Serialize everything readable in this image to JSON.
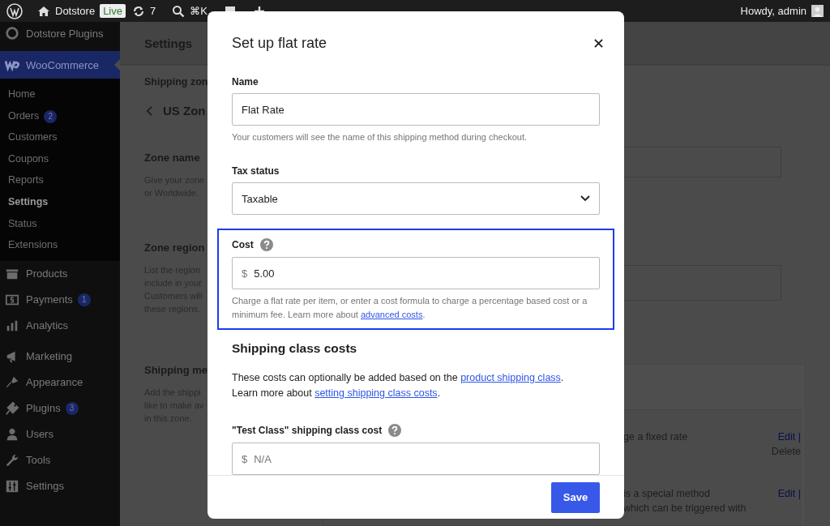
{
  "admin_bar": {
    "site_name": "Dotstore",
    "live_badge": "Live",
    "updates": "7",
    "search_shortcut": "⌘K",
    "greeting": "Howdy, admin"
  },
  "sidebar": {
    "items": [
      {
        "label": "Dotstore Plugins",
        "selected": false
      },
      {
        "label": "WooCommerce",
        "selected": true,
        "children": [
          {
            "label": "Home",
            "selected": false
          },
          {
            "label": "Orders",
            "badge": "2",
            "selected": false
          },
          {
            "label": "Customers",
            "selected": false
          },
          {
            "label": "Coupons",
            "selected": false
          },
          {
            "label": "Reports",
            "selected": false
          },
          {
            "label": "Settings",
            "selected": true
          },
          {
            "label": "Status",
            "selected": false
          },
          {
            "label": "Extensions",
            "selected": false
          }
        ]
      },
      {
        "label": "Products",
        "selected": false
      },
      {
        "label": "Payments",
        "badge": "1",
        "selected": false
      },
      {
        "label": "Analytics",
        "selected": false
      },
      {
        "label": "Marketing",
        "selected": false
      },
      {
        "label": "Appearance",
        "selected": false
      },
      {
        "label": "Plugins",
        "badge": "3",
        "selected": false
      },
      {
        "label": "Users",
        "selected": false
      },
      {
        "label": "Tools",
        "selected": false
      },
      {
        "label": "Settings",
        "selected": false
      }
    ]
  },
  "main": {
    "page_title": "Settings",
    "breadcrumb": "Shipping zon",
    "zone_title": "US Zon",
    "sections": [
      {
        "heading": "Zone name",
        "lines": [
          "Give your zone",
          "or Worldwide."
        ]
      },
      {
        "heading": "Zone region",
        "lines": [
          "List the region",
          "include in your",
          "Customers will",
          "these regions."
        ]
      },
      {
        "heading": "Shipping me",
        "lines": [
          "Add the shippi",
          "like to make av",
          "in this zone."
        ]
      }
    ],
    "methods": [
      {
        "description": [
          "ge a fixed rate"
        ],
        "actions": [
          "Edit |",
          "Delete"
        ]
      },
      {
        "description": [
          "is a special method",
          "which can be triggered with"
        ],
        "actions": [
          "Edit |"
        ]
      }
    ]
  },
  "modal": {
    "title": "Set up flat rate",
    "blocks": [
      {
        "kind": "text",
        "label": "Name",
        "value": "Flat Rate",
        "help": "Your customers will see the name of this shipping method during checkout.",
        "help_icon": false,
        "highlighted": false
      },
      {
        "kind": "select",
        "label": "Tax status",
        "value": "Taxable",
        "help_icon": false,
        "highlighted": false
      },
      {
        "kind": "money",
        "label": "Cost",
        "currency": "$",
        "value": "5.00",
        "help": "Charge a flat rate per item, or enter a cost formula to charge a percentage based cost or a minimum fee. Learn more about ",
        "help_link": "advanced costs",
        "help_end": ".",
        "help_icon": true,
        "highlighted": true
      },
      {
        "kind": "heading",
        "text": "Shipping class costs"
      },
      {
        "kind": "paragraph",
        "lines": [
          [
            {
              "kind": "text",
              "text": "These costs can optionally be added based on the "
            },
            {
              "kind": "link",
              "text": "product shipping class"
            },
            {
              "kind": "text",
              "text": "."
            }
          ],
          [
            {
              "kind": "text",
              "text": "Learn more about "
            },
            {
              "kind": "link",
              "text": "setting shipping class costs"
            },
            {
              "kind": "text",
              "text": "."
            }
          ]
        ]
      },
      {
        "kind": "money",
        "label": "\"Test Class\" shipping class cost",
        "currency": "$",
        "placeholder": "N/A",
        "help_icon": true,
        "highlighted": false
      }
    ],
    "save_button": "Save"
  }
}
